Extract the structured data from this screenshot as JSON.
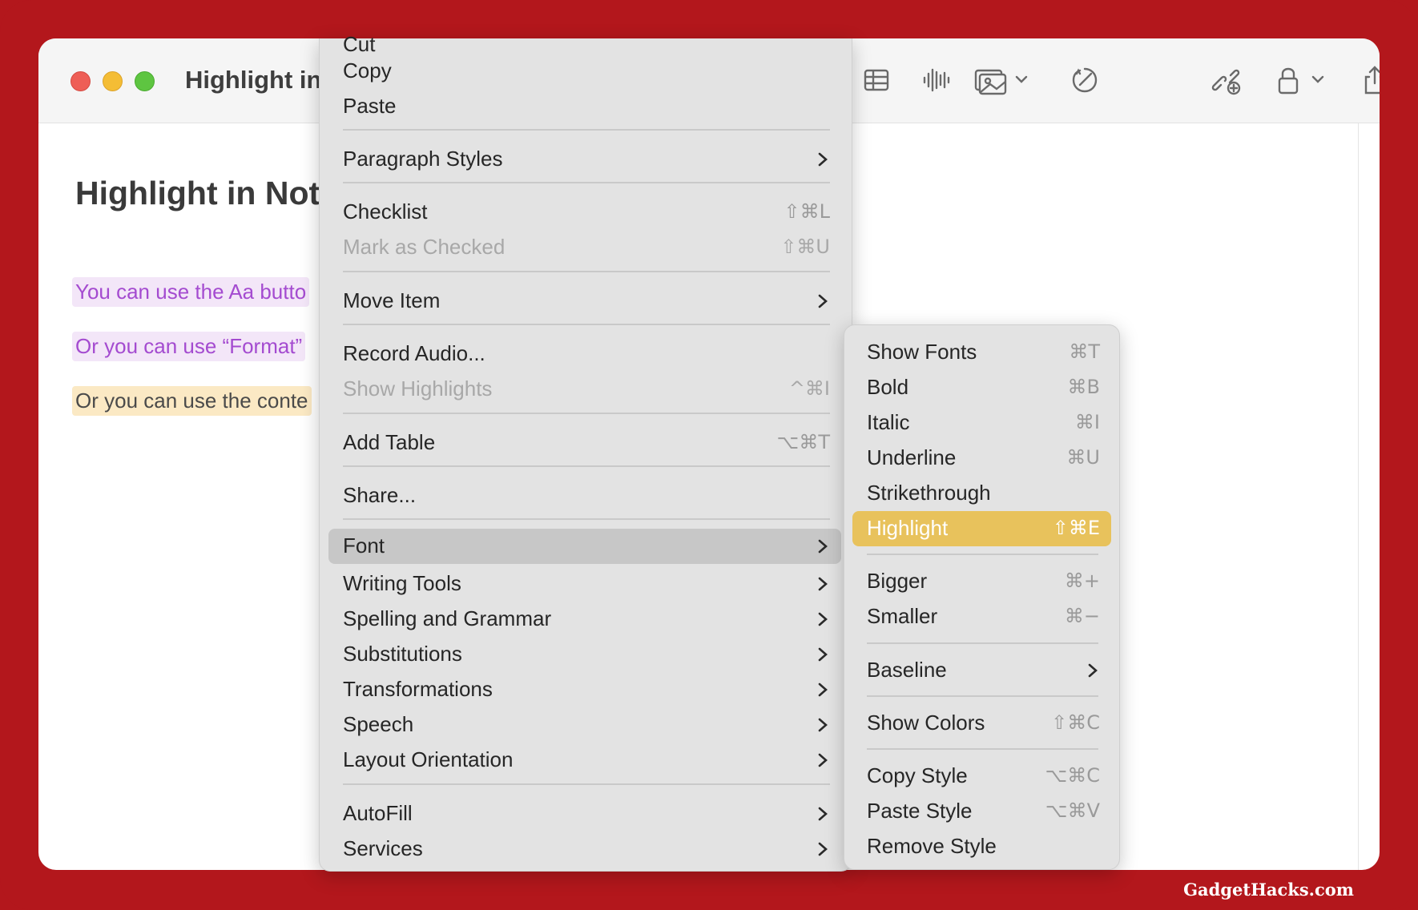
{
  "window": {
    "title": "Highlight in",
    "toolbar_icons": [
      "table-icon",
      "audio-waveform-icon",
      "media-icon",
      "writing-tools-icon",
      "collaborate-icon",
      "lock-icon",
      "share-icon"
    ]
  },
  "note": {
    "heading": "Highlight in Note",
    "lines": [
      "You can use the Aa butto",
      "Or you can use “Format”",
      "Or you can use the conte"
    ],
    "highlight_colors": {
      "purple_text": "#a44bd0",
      "purple_bg": "#f3e6f8",
      "yellow_bg": "#fbe9c4"
    }
  },
  "context_menu": {
    "partial_top_label": "Cut",
    "items": [
      {
        "label": "Copy"
      },
      {
        "label": "Paste"
      },
      {
        "label": "Paragraph Styles"
      },
      {
        "label": "Checklist",
        "shortcut": "⇧⌘L"
      },
      {
        "label": "Mark as Checked",
        "shortcut": "⇧⌘U"
      },
      {
        "label": "Move Item"
      },
      {
        "label": "Record Audio..."
      },
      {
        "label": "Show Highlights",
        "shortcut": "^⌘I"
      },
      {
        "label": "Add Table",
        "shortcut": "⌥⌘T"
      },
      {
        "label": "Share..."
      },
      {
        "label": "Font"
      },
      {
        "label": "Writing Tools"
      },
      {
        "label": "Spelling and Grammar"
      },
      {
        "label": "Substitutions"
      },
      {
        "label": "Transformations"
      },
      {
        "label": "Speech"
      },
      {
        "label": "Layout Orientation"
      },
      {
        "label": "AutoFill"
      },
      {
        "label": "Services"
      }
    ]
  },
  "font_submenu": {
    "items": [
      {
        "label": "Show Fonts",
        "shortcut": "⌘T"
      },
      {
        "label": "Bold",
        "shortcut": "⌘B"
      },
      {
        "label": "Italic",
        "shortcut": "⌘I"
      },
      {
        "label": "Underline",
        "shortcut": "⌘U"
      },
      {
        "label": "Strikethrough"
      },
      {
        "label": "Highlight",
        "shortcut": "⇧⌘E"
      },
      {
        "label": "Bigger",
        "shortcut": "⌘+"
      },
      {
        "label": "Smaller",
        "shortcut": "⌘−"
      },
      {
        "label": "Baseline"
      },
      {
        "label": "Show Colors",
        "shortcut": "⇧⌘C"
      },
      {
        "label": "Copy Style",
        "shortcut": "⌥⌘C"
      },
      {
        "label": "Paste Style",
        "shortcut": "⌥⌘V"
      },
      {
        "label": "Remove Style"
      }
    ],
    "selected_color": "#e8c25c"
  },
  "watermark": "GadgetHacks.com"
}
